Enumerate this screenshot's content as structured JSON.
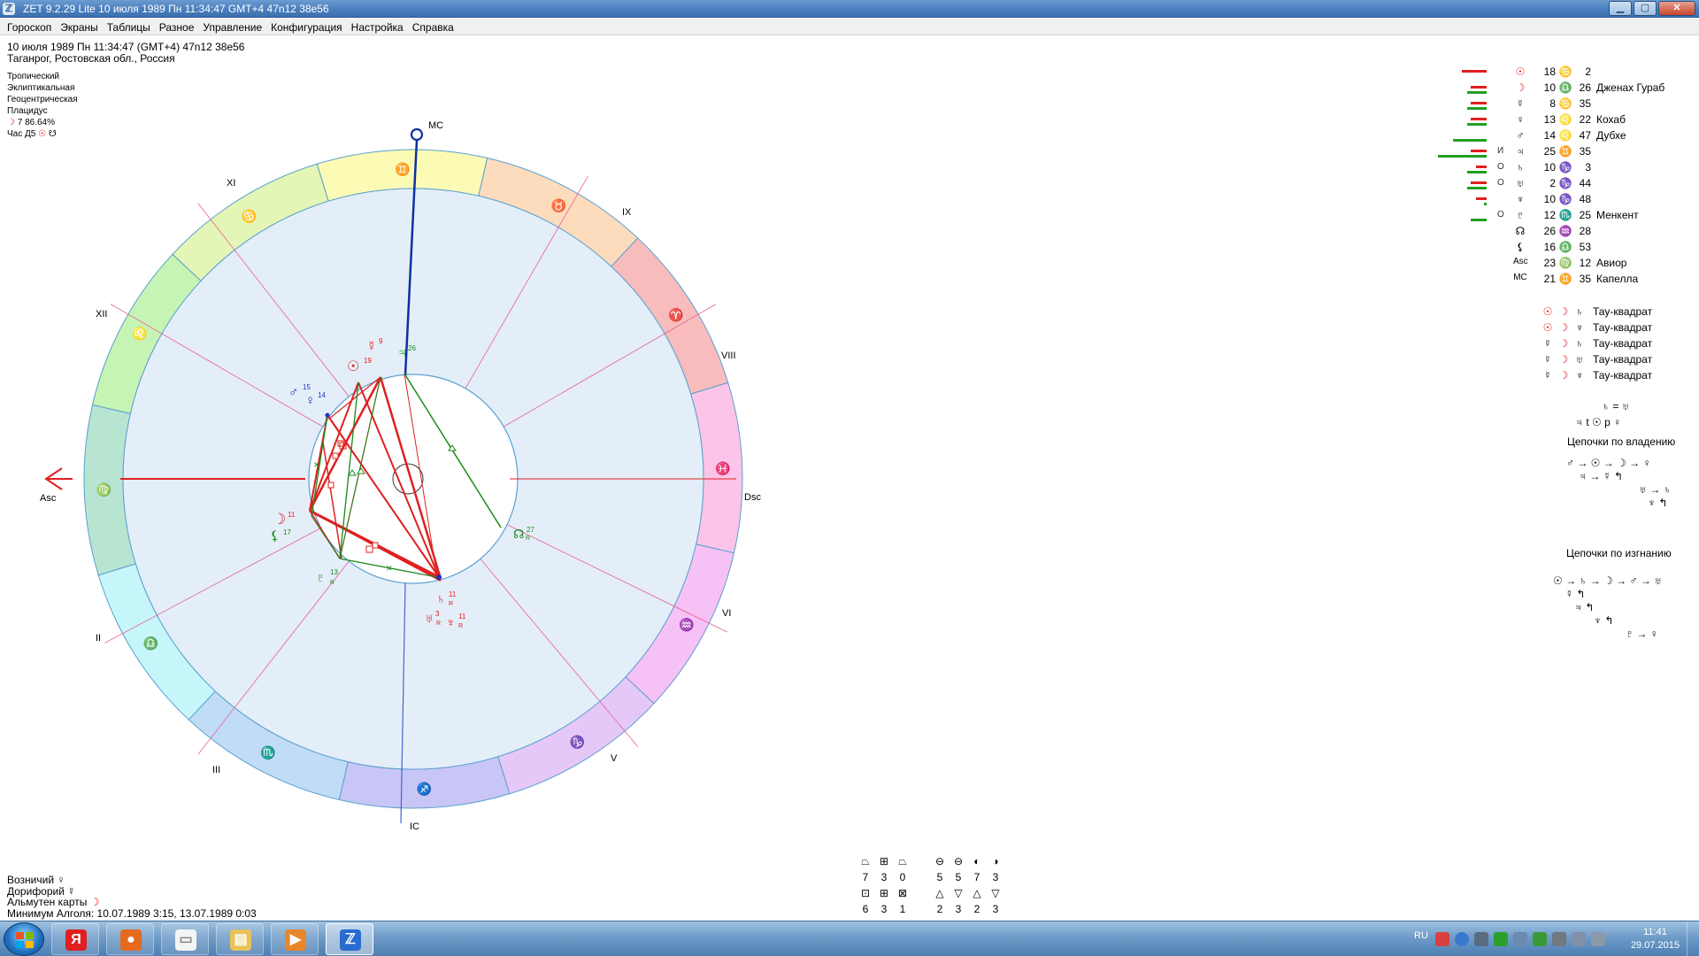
{
  "window": {
    "title": "ZET 9.2.29 Lite   10 июля 1989  Пн  11:34:47 GMT+4 47n12  38e56",
    "app_icon": "ℤ",
    "btn_min": "▁",
    "btn_max": "▢",
    "btn_close": "✕"
  },
  "menu": [
    "Гороскоп",
    "Экраны",
    "Таблицы",
    "Разное",
    "Управление",
    "Конфигурация",
    "Настройка",
    "Справка"
  ],
  "header": {
    "line1": "10 июля 1989  Пн  11:34:47 (GMT+4) 47n12  38e56",
    "line2": "Таганрог, Ростовская обл., Россия"
  },
  "params": {
    "zodiac": "Тропический",
    "coords": "Эклиптикальная",
    "center": "Геоцентрическая",
    "houses": "Плацидус",
    "moon_glyph": "☽",
    "moon_phase": " 7 86.64%",
    "hour_label": "Час Д5 ",
    "hour_glyph1": "☉",
    "hour_glyph2": "☋"
  },
  "chart": {
    "axis_labels": {
      "mc": "MC",
      "ic": "IC",
      "asc": "Asc",
      "dsc": "Dsc"
    },
    "house_numerals": [
      "XI",
      "IX",
      "VIII",
      "VI",
      "V",
      "III",
      "II",
      "XII"
    ],
    "signs": [
      "♊",
      "♉",
      "♈",
      "♓",
      "♒",
      "♑",
      "♐",
      "♏",
      "♎",
      "♍",
      "♌",
      "♋"
    ],
    "planets": [
      {
        "glyph": "☿",
        "num": "9"
      },
      {
        "glyph": "☉",
        "num": "19"
      },
      {
        "glyph": "♃",
        "num": "26"
      },
      {
        "glyph": "♂",
        "num": "15"
      },
      {
        "glyph": "♀",
        "num": "14"
      },
      {
        "glyph": "☽",
        "num": "11"
      },
      {
        "glyph": "⚸",
        "num": "17"
      },
      {
        "glyph": "♇",
        "num": "13"
      },
      {
        "glyph": "♄",
        "num": "11"
      },
      {
        "glyph": "♅",
        "num": "3"
      },
      {
        "glyph": "♆",
        "num": "11"
      },
      {
        "glyph": "☊",
        "num": "27"
      }
    ],
    "retro": "R",
    "colors": {
      "asc_axis": "#e02020",
      "mc_axis": "#1030a0",
      "aspect_red": "#e02020",
      "aspect_green": "#1a8a1a"
    }
  },
  "planet_table": [
    {
      "glyph": "☉",
      "mark": "",
      "deg": "18",
      "sign": "♋",
      "min": "2",
      "star": "",
      "bar_red": 28,
      "bar_green": 0
    },
    {
      "glyph": "☽",
      "mark": "",
      "deg": "10",
      "sign": "♎",
      "min": "26",
      "star": "Дженах Гураб",
      "bar_red": 18,
      "bar_green": 22
    },
    {
      "glyph": "☿",
      "mark": "",
      "deg": "8",
      "sign": "♋",
      "min": "35",
      "star": "",
      "bar_red": 18,
      "bar_green": 22
    },
    {
      "glyph": "♀",
      "mark": "",
      "deg": "13",
      "sign": "♌",
      "min": "22",
      "star": "Кохаб",
      "bar_red": 18,
      "bar_green": 22
    },
    {
      "glyph": "♂",
      "mark": "",
      "deg": "14",
      "sign": "♌",
      "min": "47",
      "star": "Дубхе",
      "bar_red": 0,
      "bar_green": 38
    },
    {
      "glyph": "♃",
      "mark": "И",
      "deg": "25",
      "sign": "♊",
      "min": "35",
      "star": "",
      "bar_red": 18,
      "bar_green": 55
    },
    {
      "glyph": "♄",
      "mark": "О",
      "deg": "10",
      "sign": "♑",
      "min": "3",
      "star": "",
      "bar_red": 12,
      "bar_green": 22
    },
    {
      "glyph": "♅",
      "mark": "О",
      "deg": "2",
      "sign": "♑",
      "min": "44",
      "star": "",
      "bar_red": 18,
      "bar_green": 22
    },
    {
      "glyph": "♆",
      "mark": "",
      "deg": "10",
      "sign": "♑",
      "min": "48",
      "star": "",
      "bar_red": 12,
      "bar_green": 3
    },
    {
      "glyph": "♇",
      "mark": "О",
      "deg": "12",
      "sign": "♏",
      "min": "25",
      "star": "Менкент",
      "bar_red": 0,
      "bar_green": 18
    },
    {
      "glyph": "☊",
      "mark": "",
      "deg": "26",
      "sign": "♒",
      "min": "28",
      "star": "",
      "bar_red": 0,
      "bar_green": 0
    },
    {
      "glyph": "⚸",
      "mark": "",
      "deg": "16",
      "sign": "♎",
      "min": "53",
      "star": "",
      "bar_red": 0,
      "bar_green": 0
    },
    {
      "glyph": "Asc",
      "mark": "",
      "deg": "23",
      "sign": "♍",
      "min": "12",
      "star": "Авиор",
      "bar_red": 0,
      "bar_green": 0
    },
    {
      "glyph": "MC",
      "mark": "",
      "deg": "21",
      "sign": "♊",
      "min": "35",
      "star": "Капелла",
      "bar_red": 0,
      "bar_green": 0
    }
  ],
  "configurations": [
    {
      "g1": "☉",
      "g2": "☽",
      "g3": "♄",
      "label": "Тау-квадрат"
    },
    {
      "g1": "☉",
      "g2": "☽",
      "g3": "♆",
      "label": "Тау-квадрат"
    },
    {
      "g1": "☿",
      "g2": "☽",
      "g3": "♄",
      "label": "Тау-квадрат"
    },
    {
      "g1": "☿",
      "g2": "☽",
      "g3": "♅",
      "label": "Тау-квадрат"
    },
    {
      "g1": "☿",
      "g2": "☽",
      "g3": "♆",
      "label": "Тау-квадрат"
    }
  ],
  "relations": {
    "line1": "♄ = ♅",
    "line2": "♃ t ☉ p ♀"
  },
  "chains": {
    "rulership_title": "Цепочки по владению",
    "rulership_rows": [
      "♂ → ☉ → ☽ → ♀",
      "♃ → ☿ ↰",
      "♅ → ♄",
      "♆ ↰"
    ],
    "exile_title": "Цепочки по изгнанию",
    "exile_rows": [
      "☉ → ♄ → ☽ → ♂ → ♅",
      "☿ ↰",
      "♃ ↰",
      "♆ ↰",
      "♇ → ♀"
    ]
  },
  "elements": {
    "row1_syms": [
      "⏢",
      "⊞",
      "⏢",
      "⊖",
      "⊖",
      "◐",
      "◑"
    ],
    "row1_vals": [
      "7",
      "3",
      "0",
      "5",
      "5",
      "7",
      "3"
    ],
    "row2_syms": [
      "⊡",
      "⊞",
      "⊠",
      "△",
      "▽",
      "△",
      "▽"
    ],
    "row2_vals": [
      "6",
      "3",
      "1",
      "2",
      "3",
      "2",
      "3"
    ]
  },
  "footer": {
    "voznichiy": "Возничий ",
    "voznichiy_glyph": "♀",
    "doriforiy": "Дорифорий ",
    "doriforiy_glyph": "☿",
    "almuten": "Альмутен карты ",
    "almuten_glyph": "☽",
    "algol": "Минимум Алголя: 10.07.1989  3:15,  13.07.1989  0:03"
  },
  "taskbar": {
    "lang": "RU",
    "time": "11:41",
    "date": "29.07.2015",
    "apps": [
      {
        "name": "yandex",
        "glyph": "Я",
        "color": "#e02020"
      },
      {
        "name": "firefox",
        "glyph": "●",
        "color": "#e66a1e"
      },
      {
        "name": "document",
        "glyph": "▭",
        "color": "#f4f4f4"
      },
      {
        "name": "explorer",
        "glyph": "▤",
        "color": "#e8c25a"
      },
      {
        "name": "media",
        "glyph": "▶",
        "color": "#e8862a"
      },
      {
        "name": "zet",
        "glyph": "ℤ",
        "color": "#2a6bd0"
      }
    ]
  }
}
